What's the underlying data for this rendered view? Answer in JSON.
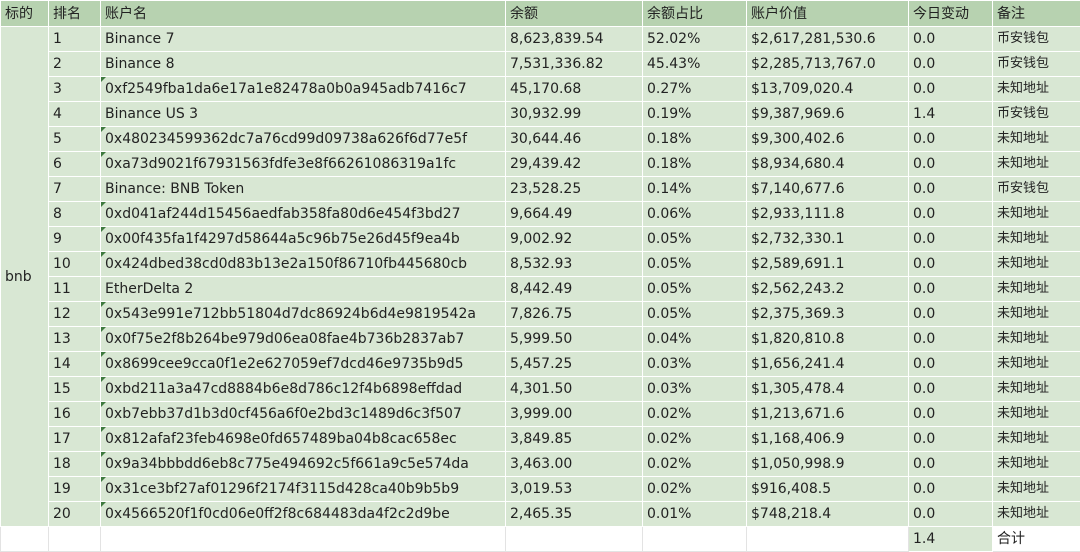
{
  "headers": [
    "标的",
    "排名",
    "账户名",
    "余额",
    "余额占比",
    "账户价值",
    "今日变动",
    "备注"
  ],
  "asset_label": "bnb",
  "rows": [
    {
      "rank": "1",
      "account": "Binance 7",
      "balance": "8,623,839.54",
      "pct": "52.02%",
      "value": "$2,617,281,530.6",
      "change": "0.0",
      "note": "币安钱包",
      "flag": false
    },
    {
      "rank": "2",
      "account": "Binance 8",
      "balance": "7,531,336.82",
      "pct": "45.43%",
      "value": "$2,285,713,767.0",
      "change": "0.0",
      "note": "币安钱包",
      "flag": false
    },
    {
      "rank": "3",
      "account": "0xf2549fba1da6e17a1e82478a0b0a945adb7416c7",
      "balance": "45,170.68",
      "pct": "0.27%",
      "value": "$13,709,020.4",
      "change": "0.0",
      "note": "未知地址",
      "flag": true
    },
    {
      "rank": "4",
      "account": "Binance US 3",
      "balance": "30,932.99",
      "pct": "0.19%",
      "value": "$9,387,969.6",
      "change": "1.4",
      "note": "币安钱包",
      "flag": false
    },
    {
      "rank": "5",
      "account": "0x480234599362dc7a76cd99d09738a626f6d77e5f",
      "balance": "30,644.46",
      "pct": "0.18%",
      "value": "$9,300,402.6",
      "change": "0.0",
      "note": "未知地址",
      "flag": true
    },
    {
      "rank": "6",
      "account": "0xa73d9021f67931563fdfe3e8f66261086319a1fc",
      "balance": "29,439.42",
      "pct": "0.18%",
      "value": "$8,934,680.4",
      "change": "0.0",
      "note": "未知地址",
      "flag": true
    },
    {
      "rank": "7",
      "account": " Binance: BNB Token",
      "balance": "23,528.25",
      "pct": "0.14%",
      "value": "$7,140,677.6",
      "change": "0.0",
      "note": "币安钱包",
      "flag": false
    },
    {
      "rank": "8",
      "account": "0xd041af244d15456aedfab358fa80d6e454f3bd27",
      "balance": "9,664.49",
      "pct": "0.06%",
      "value": "$2,933,111.8",
      "change": "0.0",
      "note": "未知地址",
      "flag": true
    },
    {
      "rank": "9",
      "account": "0x00f435fa1f4297d58644a5c96b75e26d45f9ea4b",
      "balance": "9,002.92",
      "pct": "0.05%",
      "value": "$2,732,330.1",
      "change": "0.0",
      "note": "未知地址",
      "flag": true
    },
    {
      "rank": "10",
      "account": "0x424dbed38cd0d83b13e2a150f86710fb445680cb",
      "balance": "8,532.93",
      "pct": "0.05%",
      "value": "$2,589,691.1",
      "change": "0.0",
      "note": "未知地址",
      "flag": true
    },
    {
      "rank": "11",
      "account": " EtherDelta 2",
      "balance": "8,442.49",
      "pct": "0.05%",
      "value": "$2,562,243.2",
      "change": "0.0",
      "note": "未知地址",
      "flag": false
    },
    {
      "rank": "12",
      "account": "0x543e991e712bb51804d7dc86924b6d4e9819542a",
      "balance": "7,826.75",
      "pct": "0.05%",
      "value": "$2,375,369.3",
      "change": "0.0",
      "note": "未知地址",
      "flag": true
    },
    {
      "rank": "13",
      "account": "0x0f75e2f8b264be979d06ea08fae4b736b2837ab7",
      "balance": "5,999.50",
      "pct": "0.04%",
      "value": "$1,820,810.8",
      "change": "0.0",
      "note": "未知地址",
      "flag": true
    },
    {
      "rank": "14",
      "account": "0x8699cee9cca0f1e2e627059ef7dcd46e9735b9d5",
      "balance": "5,457.25",
      "pct": "0.03%",
      "value": "$1,656,241.4",
      "change": "0.0",
      "note": "未知地址",
      "flag": true
    },
    {
      "rank": "15",
      "account": "0xbd211a3a47cd8884b6e8d786c12f4b6898effdad",
      "balance": "4,301.50",
      "pct": "0.03%",
      "value": "$1,305,478.4",
      "change": "0.0",
      "note": "未知地址",
      "flag": true
    },
    {
      "rank": "16",
      "account": "0xb7ebb37d1b3d0cf456a6f0e2bd3c1489d6c3f507",
      "balance": "3,999.00",
      "pct": "0.02%",
      "value": "$1,213,671.6",
      "change": "0.0",
      "note": "未知地址",
      "flag": true
    },
    {
      "rank": "17",
      "account": "0x812afaf23feb4698e0fd657489ba04b8cac658ec",
      "balance": "3,849.85",
      "pct": "0.02%",
      "value": "$1,168,406.9",
      "change": "0.0",
      "note": "未知地址",
      "flag": true
    },
    {
      "rank": "18",
      "account": "0x9a34bbbdd6eb8c775e494692c5f661a9c5e574da",
      "balance": "3,463.00",
      "pct": "0.02%",
      "value": "$1,050,998.9",
      "change": "0.0",
      "note": "未知地址",
      "flag": true
    },
    {
      "rank": "19",
      "account": "0x31ce3bf27af01296f2174f3115d428ca40b9b5b9",
      "balance": "3,019.53",
      "pct": "0.02%",
      "value": "$916,408.5",
      "change": "0.0",
      "note": "未知地址",
      "flag": true
    },
    {
      "rank": "20",
      "account": "0x4566520f1f0cd06e0ff2f8c684483da4f2c2d9be",
      "balance": "2,465.35",
      "pct": "0.01%",
      "value": "$748,218.4",
      "change": "0.0",
      "note": "未知地址",
      "flag": true
    }
  ],
  "footer": {
    "change_total": "1.4",
    "total_label": "合计"
  },
  "colors": {
    "header_bg": "#b7d2b0",
    "cell_bg": "#d8e7d3",
    "flag": "#3f7a3f"
  }
}
